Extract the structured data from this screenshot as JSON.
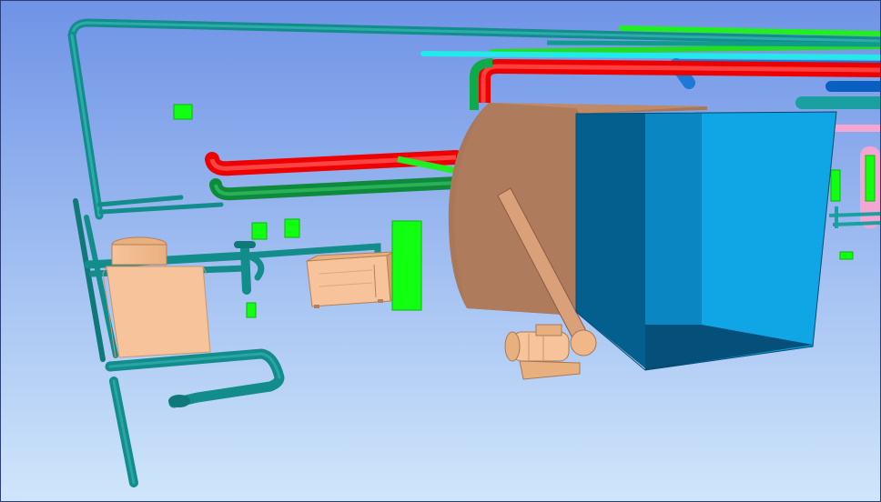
{
  "scene": {
    "background_top": "#6f93e6",
    "background_bottom": "#cfe6fb",
    "palette": {
      "teal_pipe": "#1aa0a0",
      "teal_pipe_dark": "#0f7878",
      "red_pipe": "#ff1111",
      "green_pipe": "#0faa4a",
      "lime_pipe": "#22ee22",
      "cyan_pipe": "#22eaea",
      "blue_pipe": "#1e78d6",
      "pink_pipe": "#f4a6d2",
      "equipment_tan": "#f7c39a",
      "equipment_tan_dark": "#a87858",
      "duct_blue_light": "#0b9ad8",
      "duct_blue_dark": "#035f8e",
      "marker_green": "#11ff11"
    },
    "objects": [
      {
        "name": "teal-pipe-network",
        "icon": "pipe-icon"
      },
      {
        "name": "red-pipe",
        "icon": "pipe-icon"
      },
      {
        "name": "green-pipe",
        "icon": "pipe-icon"
      },
      {
        "name": "rooftop-pump-unit",
        "icon": "pump-icon"
      },
      {
        "name": "control-cabinet",
        "icon": "cabinet-icon"
      },
      {
        "name": "centrifugal-fan-housing",
        "icon": "fan-icon"
      },
      {
        "name": "drive-motor",
        "icon": "motor-icon"
      },
      {
        "name": "duct-plenum-box",
        "icon": "duct-icon"
      },
      {
        "name": "green-marker-blocks",
        "icon": "marker-icon"
      }
    ]
  }
}
